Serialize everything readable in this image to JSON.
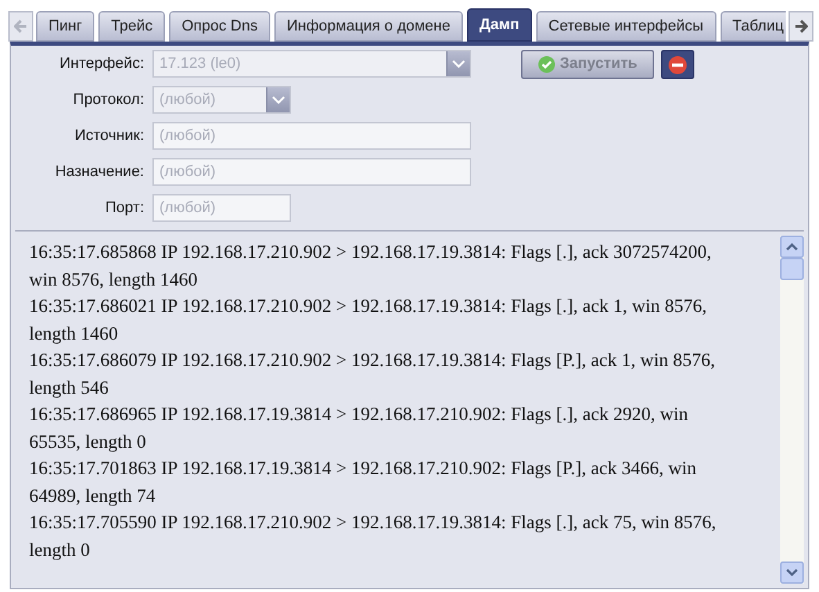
{
  "tabs": [
    {
      "label": "Пинг",
      "selected": false
    },
    {
      "label": "Трейс",
      "selected": false
    },
    {
      "label": "Опрос Dns",
      "selected": false
    },
    {
      "label": "Информация о домене",
      "selected": false
    },
    {
      "label": "Дамп",
      "selected": true
    },
    {
      "label": "Сетевые интерфейсы",
      "selected": false
    },
    {
      "label": "Таблиц",
      "selected": false
    }
  ],
  "tab_scroll": {
    "left_disabled": true,
    "right_disabled": false
  },
  "form": [
    {
      "kind": "combo",
      "label": "Интерфейс:",
      "value": "17.123 (le0)",
      "wide": true
    },
    {
      "kind": "combo",
      "label": "Протокол:",
      "placeholder": "(любой)",
      "wide": false
    },
    {
      "kind": "input",
      "label": "Источник:",
      "placeholder": "(любой)",
      "wide": true
    },
    {
      "kind": "input",
      "label": "Назначение:",
      "placeholder": "(любой)",
      "wide": true
    },
    {
      "kind": "input",
      "label": "Порт:",
      "placeholder": "(любой)",
      "wide": false
    }
  ],
  "start_button": {
    "label": "Запустить",
    "disabled": true
  },
  "log": [
    "16:35:17.685868 IP 192.168.17.210.902 > 192.168.17.19.3814: Flags [.], ack 3072574200, win 8576, length 1460",
    "16:35:17.686021 IP 192.168.17.210.902 > 192.168.17.19.3814: Flags [.], ack 1, win 8576, length 1460",
    "16:35:17.686079 IP 192.168.17.210.902 > 192.168.17.19.3814: Flags [P.], ack 1, win 8576, length 546",
    "16:35:17.686965 IP 192.168.17.19.3814 > 192.168.17.210.902: Flags [.], ack 2920, win 65535, length 0",
    "16:35:17.701863 IP 192.168.17.19.3814 > 192.168.17.210.902: Flags [P.], ack 3466, win 64989, length 74",
    "16:35:17.705590 IP 192.168.17.210.902 > 192.168.17.19.3814: Flags [.], ack 75, win 8576, length 0"
  ]
}
